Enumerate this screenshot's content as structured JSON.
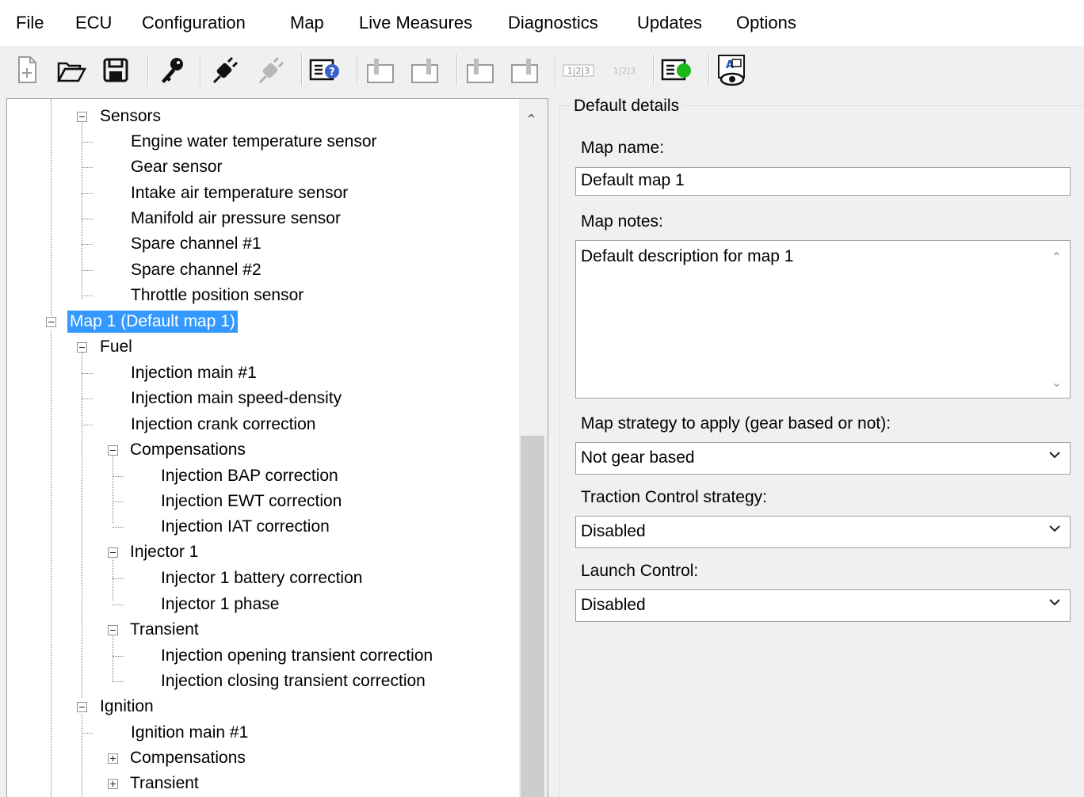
{
  "menu": [
    "File",
    "ECU",
    "Configuration",
    "Map",
    "Live Measures",
    "Diagnostics",
    "Updates",
    "Options"
  ],
  "toolbar_icons": [
    "new-file-icon",
    "open-folder-icon",
    "save-icon",
    "key-icon",
    "connect-plug-icon",
    "disconnect-plug-icon",
    "ecu-info-icon",
    "upload-icon",
    "upload-active-icon",
    "download-icon",
    "download-active-icon",
    "compare-icon",
    "compare-disabled-icon",
    "ecu-status-green-icon",
    "view-eye-icon"
  ],
  "tree": {
    "sensors": {
      "label": "Sensors",
      "children": [
        "Engine water temperature sensor",
        "Gear sensor",
        "Intake air temperature sensor",
        "Manifold air pressure sensor",
        "Spare channel #1",
        "Spare channel #2",
        "Throttle position sensor"
      ]
    },
    "map1": "Map 1 (Default map 1)",
    "fuel": {
      "label": "Fuel",
      "children": [
        "Injection main #1",
        "Injection main speed-density",
        "Injection crank correction"
      ],
      "compensations": {
        "label": "Compensations",
        "children": [
          "Injection BAP correction",
          "Injection EWT correction",
          "Injection IAT correction"
        ]
      },
      "injector1": {
        "label": "Injector 1",
        "children": [
          "Injector 1 battery correction",
          "Injector 1 phase"
        ]
      },
      "transient": {
        "label": "Transient",
        "children": [
          "Injection opening transient correction",
          "Injection closing transient correction"
        ]
      }
    },
    "ignition": {
      "label": "Ignition",
      "children": [
        "Ignition main #1",
        "Compensations",
        "Transient"
      ]
    }
  },
  "details": {
    "legend": "Default details",
    "map_name_label": "Map name:",
    "map_name_value": "Default map 1",
    "map_notes_label": "Map notes:",
    "map_notes_value": "Default description for map 1",
    "strategy_label": "Map strategy to apply (gear based or not):",
    "strategy_value": "Not gear based",
    "traction_label": "Traction Control strategy:",
    "traction_value": "Disabled",
    "launch_label": "Launch Control:",
    "launch_value": "Disabled"
  },
  "colors": {
    "selection": "#3399ff",
    "ecu_status": "#19b919"
  }
}
